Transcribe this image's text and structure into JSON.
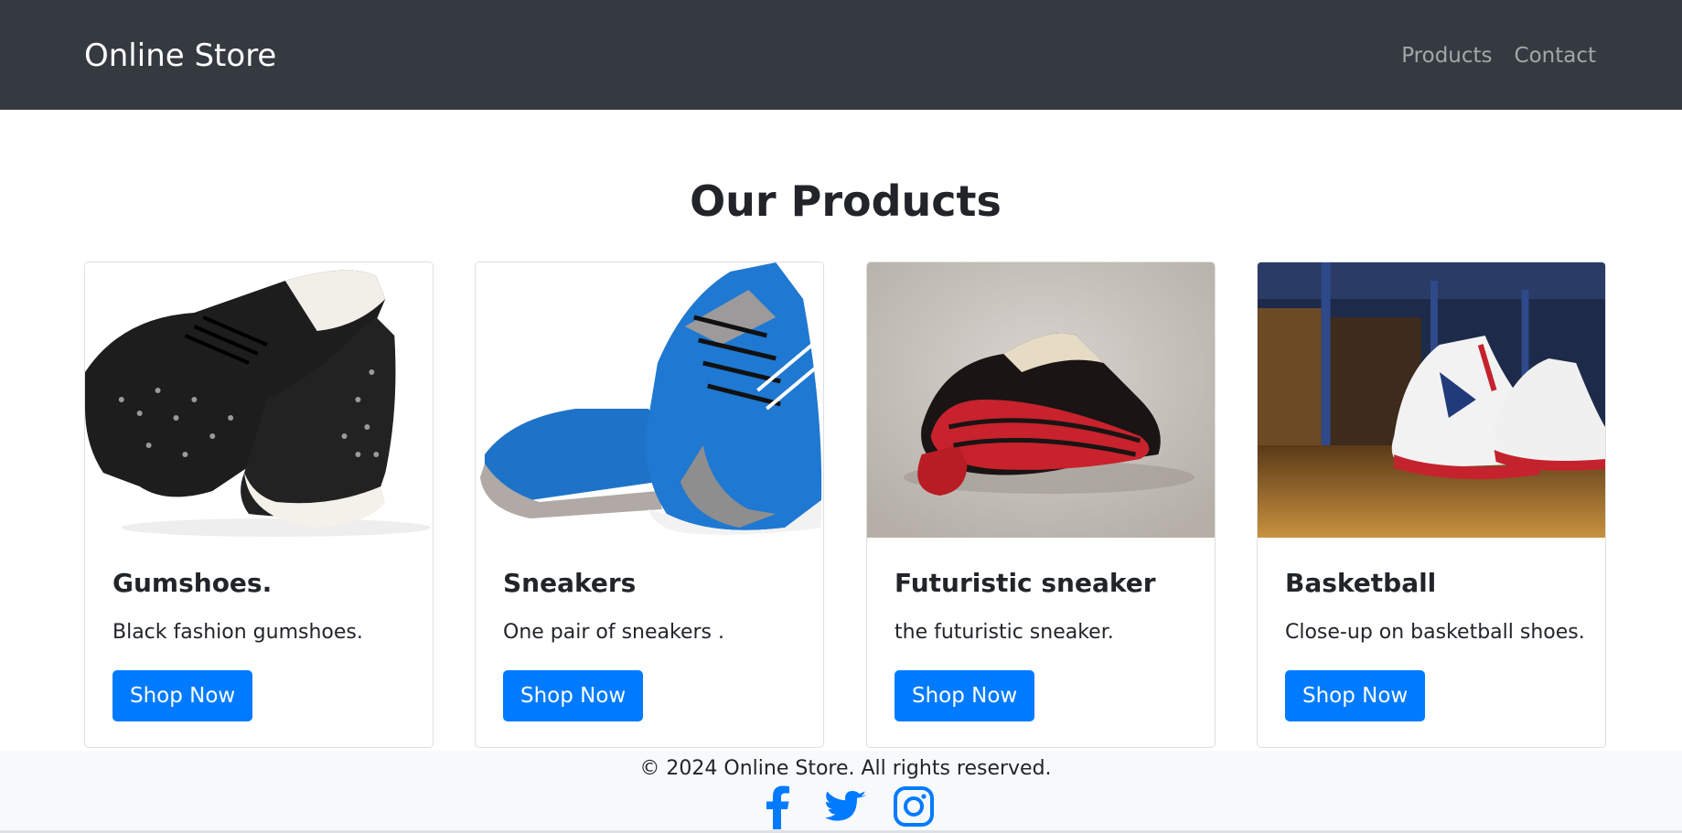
{
  "navbar": {
    "brand": "Online Store",
    "links": [
      {
        "label": "Products"
      },
      {
        "label": "Contact"
      }
    ]
  },
  "main": {
    "title": "Our Products",
    "products": [
      {
        "name": "Gumshoes.",
        "description": "Black fashion gumshoes.",
        "button": "Shop Now",
        "image_alt": "studded-black-high-top-shoes"
      },
      {
        "name": "Sneakers",
        "description": "One pair of sneakers .",
        "button": "Shop Now",
        "image_alt": "blue-running-sneakers"
      },
      {
        "name": "Futuristic sneaker",
        "description": "the futuristic sneaker.",
        "button": "Shop Now",
        "image_alt": "black-red-futuristic-sneaker"
      },
      {
        "name": "Basketball",
        "description": "Close-up on basketball shoes.",
        "button": "Shop Now",
        "image_alt": "white-red-basketball-shoes"
      }
    ]
  },
  "footer": {
    "copyright": "© 2024 Online Store. All rights reserved.",
    "social": [
      {
        "icon": "facebook-icon"
      },
      {
        "icon": "twitter-icon"
      },
      {
        "icon": "instagram-icon"
      }
    ]
  },
  "colors": {
    "navbar_bg": "#343a40",
    "primary": "#007bff",
    "footer_bg": "#f8f9fa"
  }
}
